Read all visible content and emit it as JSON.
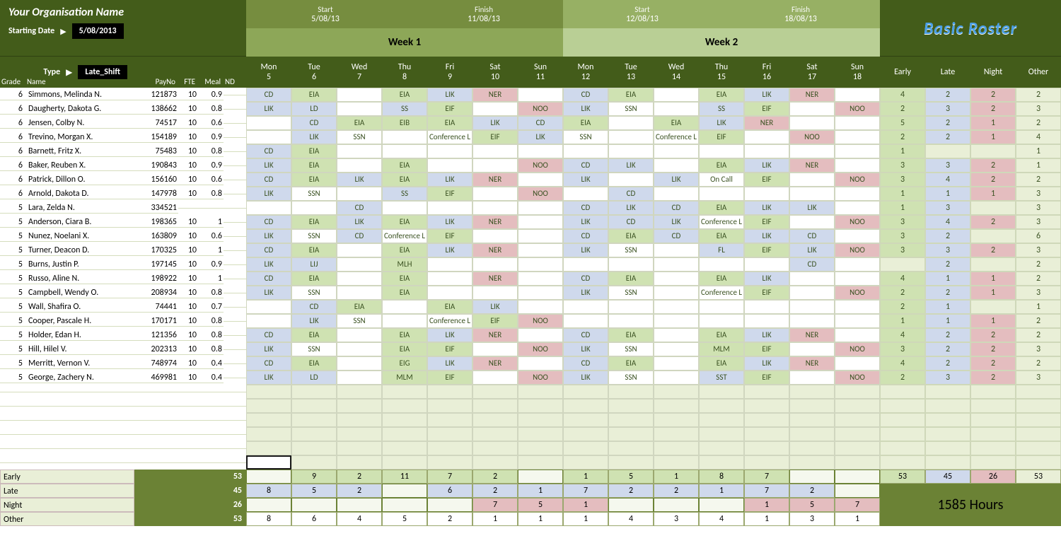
{
  "header": {
    "org": "Your Organisation Name",
    "starting_date_label": "Starting Date",
    "starting_date": "5/08/2013",
    "type_label": "Type",
    "type_value": "Late_Shift",
    "brand": "Basic Roster"
  },
  "weeks": [
    {
      "label": "Week 1",
      "start_lbl": "Start",
      "finish_lbl": "Finish",
      "start": "5/08/13",
      "finish": "11/08/13",
      "days": [
        {
          "dow": "Mon",
          "num": "5"
        },
        {
          "dow": "Tue",
          "num": "6"
        },
        {
          "dow": "Wed",
          "num": "7"
        },
        {
          "dow": "Thu",
          "num": "8"
        },
        {
          "dow": "Fri",
          "num": "9"
        },
        {
          "dow": "Sat",
          "num": "10"
        },
        {
          "dow": "Sun",
          "num": "11"
        }
      ]
    },
    {
      "label": "Week 2",
      "start_lbl": "Start",
      "finish_lbl": "Finish",
      "start": "12/08/13",
      "finish": "18/08/13",
      "days": [
        {
          "dow": "Mon",
          "num": "12"
        },
        {
          "dow": "Tue",
          "num": "13"
        },
        {
          "dow": "Wed",
          "num": "14"
        },
        {
          "dow": "Thu",
          "num": "15"
        },
        {
          "dow": "Fri",
          "num": "16"
        },
        {
          "dow": "Sat",
          "num": "17"
        },
        {
          "dow": "Sun",
          "num": "18"
        }
      ]
    }
  ],
  "staff_headers": {
    "grade": "Grade",
    "name": "Name",
    "payno": "PayNo",
    "fte": "FTE",
    "meal": "Meal",
    "nd": "ND"
  },
  "summary_headers": [
    "Early",
    "Late",
    "Night",
    "Other"
  ],
  "staff": [
    {
      "grade": "6",
      "name": "Simmons, Melinda N.",
      "payno": "121873",
      "fte": "10",
      "meal": "0.9",
      "w1": [
        "CD",
        "EIA",
        "",
        "EIA",
        "LIK",
        "NER",
        ""
      ],
      "w2": [
        "CD",
        "EIA",
        "",
        "EIA",
        "LIK",
        "NER",
        ""
      ],
      "sum": [
        "4",
        "2",
        "2",
        "2"
      ]
    },
    {
      "grade": "6",
      "name": "Daugherty, Dakota G.",
      "payno": "138662",
      "fte": "10",
      "meal": "0.8",
      "w1": [
        "LIK",
        "LD",
        "",
        "SS",
        "EIF",
        "",
        "NOO"
      ],
      "w2": [
        "LIK",
        "SSN",
        "",
        "SS",
        "EIF",
        "",
        "NOO"
      ],
      "sum": [
        "2",
        "3",
        "2",
        "3"
      ]
    },
    {
      "grade": "6",
      "name": "Jensen, Colby N.",
      "payno": "74517",
      "fte": "10",
      "meal": "0.6",
      "w1": [
        "",
        "CD",
        "EIA",
        "EIB",
        "EIA",
        "LIK",
        "CD"
      ],
      "w2": [
        "EIA",
        "",
        "EIA",
        "LIK",
        "NER",
        "",
        ""
      ],
      "sum": [
        "5",
        "2",
        "1",
        "2"
      ]
    },
    {
      "grade": "6",
      "name": "Trevino, Morgan X.",
      "payno": "154189",
      "fte": "10",
      "meal": "0.9",
      "w1": [
        "",
        "LIK",
        "SSN",
        "",
        "Conference L",
        "EIF",
        "LIK"
      ],
      "w2": [
        "SSN",
        "",
        "Conference L",
        "EIF",
        "",
        "NOO",
        ""
      ],
      "sum": [
        "2",
        "2",
        "1",
        "4"
      ]
    },
    {
      "grade": "6",
      "name": "Barnett, Fritz X.",
      "payno": "75483",
      "fte": "10",
      "meal": "0.8",
      "w1": [
        "CD",
        "EIA",
        "",
        "",
        "",
        "",
        ""
      ],
      "w2": [
        "",
        "",
        "",
        "",
        "",
        "",
        ""
      ],
      "sum": [
        "1",
        "",
        "",
        "1"
      ]
    },
    {
      "grade": "6",
      "name": "Baker, Reuben X.",
      "payno": "190843",
      "fte": "10",
      "meal": "0.9",
      "w1": [
        "LIK",
        "EIA",
        "",
        "EIA",
        "",
        "",
        "NOO"
      ],
      "w2": [
        "CD",
        "LIK",
        "",
        "EIA",
        "LIK",
        "NER",
        ""
      ],
      "sum": [
        "3",
        "3",
        "2",
        "1"
      ]
    },
    {
      "grade": "6",
      "name": "Patrick, Dillon O.",
      "payno": "156160",
      "fte": "10",
      "meal": "0.6",
      "w1": [
        "CD",
        "EIA",
        "LIK",
        "EIA",
        "LIK",
        "NER",
        ""
      ],
      "w2": [
        "LIK",
        "",
        "LIK",
        "On Call",
        "EIF",
        "",
        "NOO"
      ],
      "sum": [
        "3",
        "4",
        "2",
        "2"
      ]
    },
    {
      "grade": "6",
      "name": "Arnold, Dakota D.",
      "payno": "147978",
      "fte": "10",
      "meal": "0.8",
      "w1": [
        "LIK",
        "SSN",
        "",
        "SS",
        "EIF",
        "",
        "NOO"
      ],
      "w2": [
        "",
        "CD",
        "",
        "",
        "",
        "",
        ""
      ],
      "sum": [
        "1",
        "1",
        "1",
        "3"
      ]
    },
    {
      "grade": "5",
      "name": "Lara, Zelda N.",
      "payno": "334521",
      "fte": "",
      "meal": "",
      "w1": [
        "",
        "",
        "CD",
        "",
        "",
        "",
        ""
      ],
      "w2": [
        "CD",
        "LIK",
        "CD",
        "EIA",
        "LIK",
        "LIK",
        ""
      ],
      "sum": [
        "1",
        "3",
        "",
        "3"
      ]
    },
    {
      "grade": "5",
      "name": "Anderson, Ciara B.",
      "payno": "198365",
      "fte": "10",
      "meal": "1",
      "w1": [
        "CD",
        "EIA",
        "LIK",
        "EIA",
        "LIK",
        "NER",
        ""
      ],
      "w2": [
        "LIK",
        "CD",
        "LIK",
        "Conference L",
        "EIF",
        "",
        "NOO"
      ],
      "sum": [
        "3",
        "4",
        "2",
        "3"
      ]
    },
    {
      "grade": "5",
      "name": "Nunez, Noelani X.",
      "payno": "163809",
      "fte": "10",
      "meal": "0.6",
      "w1": [
        "LIK",
        "SSN",
        "CD",
        "Conference L",
        "EIF",
        "",
        ""
      ],
      "w2": [
        "CD",
        "EIA",
        "CD",
        "EIA",
        "LIK",
        "CD",
        ""
      ],
      "sum": [
        "3",
        "2",
        "",
        "6"
      ]
    },
    {
      "grade": "5",
      "name": "Turner, Deacon D.",
      "payno": "170325",
      "fte": "10",
      "meal": "1",
      "w1": [
        "CD",
        "EIA",
        "",
        "EIA",
        "LIK",
        "NER",
        ""
      ],
      "w2": [
        "LIK",
        "SSN",
        "",
        "FL",
        "EIF",
        "LIK",
        "NOO"
      ],
      "sum": [
        "3",
        "3",
        "2",
        "3"
      ]
    },
    {
      "grade": "5",
      "name": "Burns, Justin P.",
      "payno": "197145",
      "fte": "10",
      "meal": "0.9",
      "w1": [
        "LIK",
        "LIJ",
        "",
        "MLH",
        "",
        "",
        ""
      ],
      "w2": [
        "",
        "",
        "",
        "",
        "",
        "CD",
        ""
      ],
      "sum": [
        "",
        "2",
        "",
        "2"
      ]
    },
    {
      "grade": "5",
      "name": "Russo, Aline N.",
      "payno": "198922",
      "fte": "10",
      "meal": "1",
      "w1": [
        "CD",
        "EIA",
        "",
        "EIA",
        "",
        "NER",
        ""
      ],
      "w2": [
        "CD",
        "EIA",
        "",
        "EIA",
        "LIK",
        "",
        ""
      ],
      "sum": [
        "4",
        "1",
        "1",
        "2"
      ]
    },
    {
      "grade": "5",
      "name": "Campbell, Wendy O.",
      "payno": "208934",
      "fte": "10",
      "meal": "0.8",
      "w1": [
        "LIK",
        "SSN",
        "",
        "EIA",
        "",
        "",
        ""
      ],
      "w2": [
        "LIK",
        "SSN",
        "",
        "Conference L",
        "EIF",
        "",
        "NOO"
      ],
      "sum": [
        "2",
        "2",
        "1",
        "3"
      ]
    },
    {
      "grade": "5",
      "name": "Wall, Shafira O.",
      "payno": "74441",
      "fte": "10",
      "meal": "0.7",
      "w1": [
        "",
        "CD",
        "EIA",
        "",
        "EIA",
        "LIK",
        ""
      ],
      "w2": [
        "",
        "",
        "",
        "",
        "",
        "",
        ""
      ],
      "sum": [
        "2",
        "1",
        "",
        "1"
      ]
    },
    {
      "grade": "5",
      "name": "Cooper, Pascale H.",
      "payno": "170171",
      "fte": "10",
      "meal": "0.8",
      "w1": [
        "",
        "LIK",
        "SSN",
        "",
        "Conference L",
        "EIF",
        "NOO"
      ],
      "w2": [
        "",
        "",
        "",
        "",
        "",
        "",
        ""
      ],
      "sum": [
        "1",
        "1",
        "1",
        "2"
      ]
    },
    {
      "grade": "5",
      "name": "Holder, Edan H.",
      "payno": "121356",
      "fte": "10",
      "meal": "0.8",
      "w1": [
        "CD",
        "EIA",
        "",
        "EIA",
        "LIK",
        "NER",
        ""
      ],
      "w2": [
        "CD",
        "EIA",
        "",
        "EIA",
        "LIK",
        "NER",
        ""
      ],
      "sum": [
        "4",
        "2",
        "2",
        "2"
      ]
    },
    {
      "grade": "5",
      "name": "Hill, Hilel V.",
      "payno": "202313",
      "fte": "10",
      "meal": "0.8",
      "w1": [
        "LIK",
        "SSN",
        "",
        "EIA",
        "EIF",
        "",
        "NOO"
      ],
      "w2": [
        "LIK",
        "SSN",
        "",
        "MLM",
        "EIF",
        "",
        "NOO"
      ],
      "sum": [
        "3",
        "2",
        "2",
        "3"
      ]
    },
    {
      "grade": "5",
      "name": "Merritt, Vernon V.",
      "payno": "748974",
      "fte": "10",
      "meal": "0.4",
      "w1": [
        "CD",
        "EIA",
        "",
        "EIG",
        "LIK",
        "NER",
        ""
      ],
      "w2": [
        "CD",
        "EIA",
        "",
        "EIA",
        "LIK",
        "NER",
        ""
      ],
      "sum": [
        "4",
        "2",
        "2",
        "2"
      ]
    },
    {
      "grade": "5",
      "name": "George, Zachery N.",
      "payno": "469981",
      "fte": "10",
      "meal": "0.4",
      "w1": [
        "LIK",
        "LD",
        "",
        "MLM",
        "EIF",
        "",
        "NOO"
      ],
      "w2": [
        "LIK",
        "SSN",
        "",
        "SST",
        "EIF",
        "",
        "NOO"
      ],
      "sum": [
        "2",
        "3",
        "2",
        "3"
      ]
    }
  ],
  "footer": {
    "labels": [
      "Early",
      "Late",
      "Night",
      "Other"
    ],
    "totals": [
      "53",
      "45",
      "26",
      "53"
    ],
    "w1": {
      "early": [
        "",
        "9",
        "2",
        "11",
        "7",
        "2",
        ""
      ],
      "late": [
        "8",
        "5",
        "2",
        "",
        "6",
        "2",
        "1"
      ],
      "night": [
        "",
        "",
        "",
        "",
        "",
        "7",
        "5"
      ],
      "other": [
        "8",
        "6",
        "4",
        "5",
        "2",
        "1",
        "1"
      ]
    },
    "w2": {
      "early": [
        "1",
        "5",
        "1",
        "8",
        "7",
        "",
        ""
      ],
      "late": [
        "7",
        "2",
        "2",
        "1",
        "7",
        "2",
        ""
      ],
      "night": [
        "1",
        "",
        "",
        "",
        "1",
        "5",
        "7"
      ],
      "other": [
        "1",
        "4",
        "3",
        "4",
        "1",
        "3",
        "1"
      ]
    },
    "sum": [
      "53",
      "45",
      "26",
      "53"
    ],
    "hours": "1585 Hours"
  }
}
